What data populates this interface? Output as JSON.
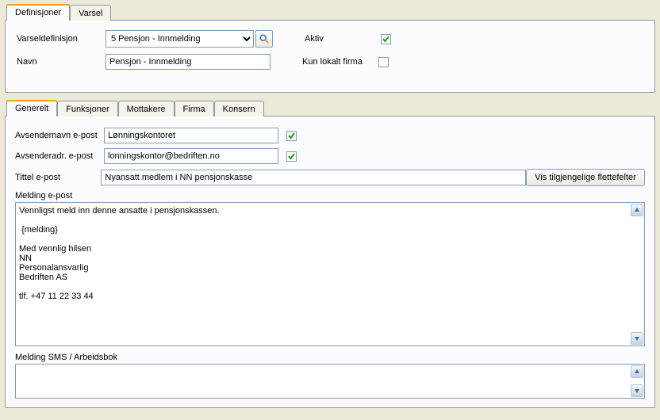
{
  "mainTabs": {
    "active": "Definisjoner",
    "other": "Varsel"
  },
  "top": {
    "labels": {
      "varseldef": "Varseldefinisjon",
      "navn": "Navn",
      "aktiv": "Aktiv",
      "kunlokalt": "Kun lokalt firma"
    },
    "varselOption": "5 Pensjon - Innmelding",
    "navnValue": "Pensjon - Innmelding",
    "aktivChecked": true,
    "kunLokaltChecked": false
  },
  "innerTabs": {
    "active": "Generelt",
    "t2": "Funksjoner",
    "t3": "Mottakere",
    "t4": "Firma",
    "t5": "Konsern"
  },
  "generelt": {
    "labels": {
      "avsNavn": "Avsendernavn e-post",
      "avsAdr": "Avsenderadr. e-post",
      "tittel": "Tittel e-post",
      "melding": "Melding e-post",
      "sms": "Melding SMS / Arbeidsbok"
    },
    "avsNavnValue": "Lønningskontoret",
    "avsNavnChecked": true,
    "avsAdrValue": "lonningskontor@bedriften.no",
    "avsAdrChecked": true,
    "tittelValue": "Nyansatt medlem i NN pensjonskasse",
    "flettefelterBtn": "Vis tilgjengelige flettefelter",
    "meldingBody": "Vennligst meld inn denne ansatte i pensjonskassen.\n\n {melding}\n\nMed vennlig hilsen\nNN\nPersonalansvarlig\nBedriften AS\n\ntlf. +47 11 22 33 44",
    "smsBody": ""
  }
}
